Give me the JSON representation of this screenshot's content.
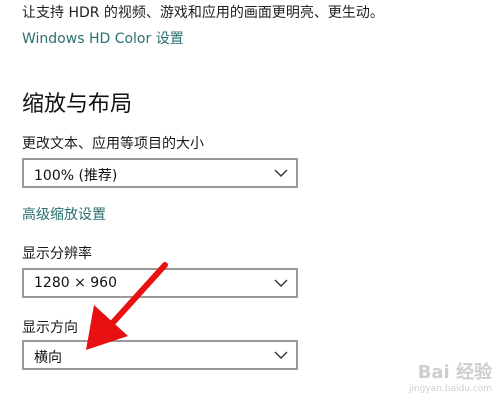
{
  "hdr": {
    "description": "让支持 HDR 的视频、游戏和应用的画面更明亮、更生动。",
    "link": "Windows HD Color 设置"
  },
  "scale_layout": {
    "title": "缩放与布局",
    "scale_label": "更改文本、应用等项目的大小",
    "scale_value": "100% (推荐)",
    "advanced_link": "高级缩放设置",
    "resolution_label": "显示分辨率",
    "resolution_value": "1280 × 960",
    "orientation_label": "显示方向",
    "orientation_value": "横向"
  },
  "annotation": {
    "arrow_color": "#e81010"
  },
  "watermark": {
    "logo": "Bai 经验",
    "url": "jingyan.baidu.com"
  },
  "colors": {
    "link": "#2b6f6f",
    "dropdown_border": "#9a9a9a"
  }
}
